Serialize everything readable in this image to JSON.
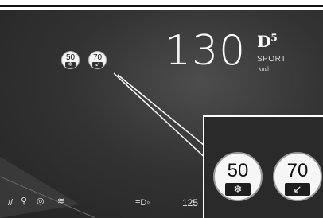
{
  "speed": {
    "value": "130",
    "gear": "D",
    "gear_number": "5",
    "mode": "SPORT",
    "unit": "km/h"
  },
  "speed_limit_signs": [
    {
      "value": "50",
      "plate_icon": "snowflake-icon",
      "plate_glyph": "❄"
    },
    {
      "value": "70",
      "plate_icon": "arrow-down-left-icon",
      "plate_glyph": "↙"
    }
  ],
  "status_bar": {
    "icons": [
      {
        "name": "fog-light-icon",
        "glyph": "//"
      },
      {
        "name": "tire-pressure-icon",
        "glyph": "⚲"
      },
      {
        "name": "steering-assist-icon",
        "glyph": "◎"
      },
      {
        "name": "lane-keep-icon",
        "glyph": "≋"
      },
      {
        "name": "parking-light-icon",
        "glyph": "≡D◦"
      }
    ],
    "odometer_partial": "125"
  },
  "colors": {
    "panel": "#333333",
    "text": "#ffffff",
    "sign_face": "#f4f4f4"
  }
}
